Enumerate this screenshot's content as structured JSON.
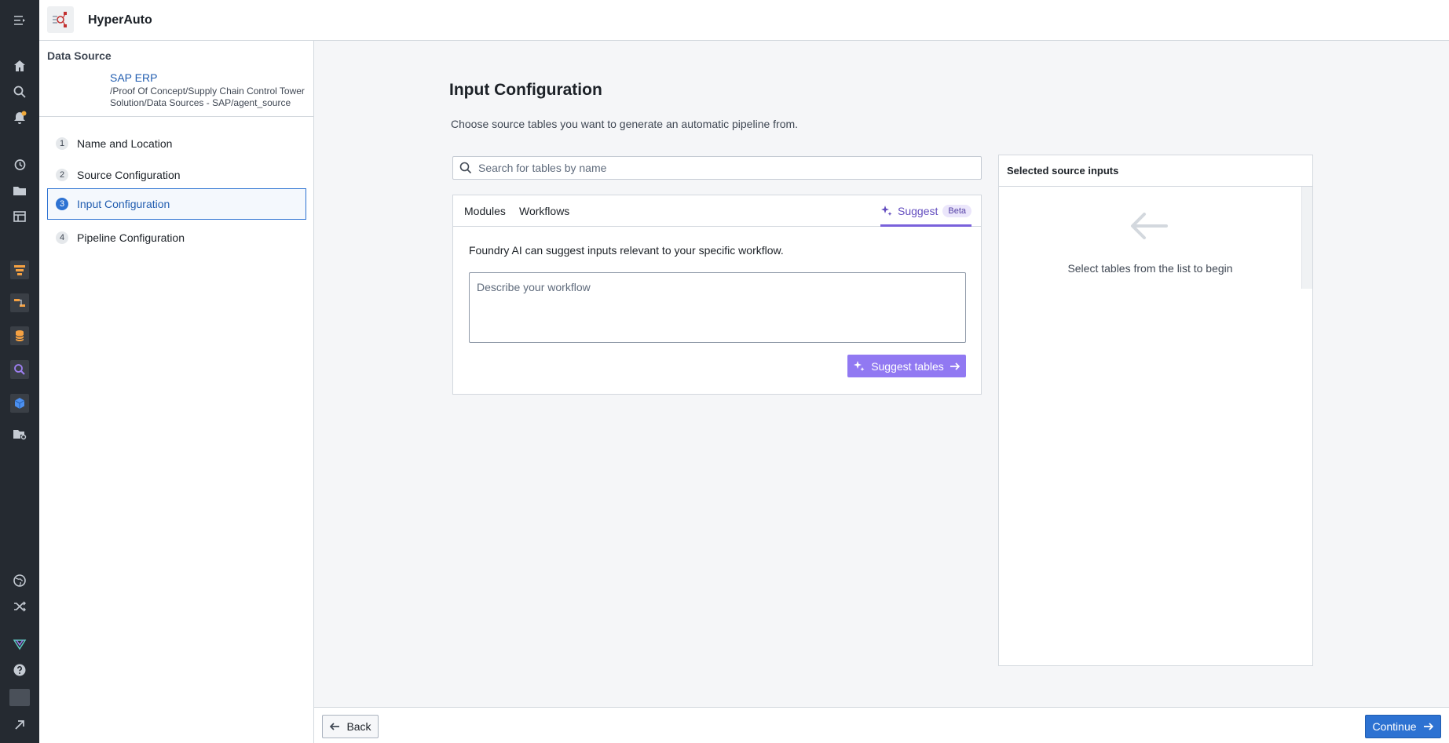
{
  "app": {
    "title": "HyperAuto"
  },
  "rail": {
    "icons": [
      "menu-icon",
      "home-icon",
      "search-icon",
      "notifications-icon",
      "history-icon",
      "folder-icon",
      "table-icon",
      "app-contour-icon",
      "app-pipeline-icon",
      "app-dataset-icon",
      "app-quiver-icon",
      "app-ontology-icon",
      "folder-settings-icon",
      "globe-icon",
      "shuffle-icon",
      "app-workshop-icon",
      "help-icon",
      "avatar",
      "expand-icon"
    ]
  },
  "sidebar": {
    "data_source_label": "Data Source",
    "source_name": "SAP ERP",
    "source_path": "/Proof Of Concept/Supply Chain Control Tower Solution/Data Sources - SAP/agent_source",
    "steps": [
      {
        "num": "1",
        "label": "Name and Location"
      },
      {
        "num": "2",
        "label": "Source Configuration"
      },
      {
        "num": "3",
        "label": "Input Configuration",
        "active": true
      },
      {
        "num": "4",
        "label": "Pipeline Configuration"
      }
    ]
  },
  "main": {
    "title": "Input Configuration",
    "subtitle": "Choose source tables you want to generate an automatic pipeline from.",
    "search_placeholder": "Search for tables by name",
    "tabs": {
      "modules": "Modules",
      "workflows": "Workflows",
      "suggest": "Suggest",
      "beta": "Beta"
    },
    "suggest_desc": "Foundry AI can suggest inputs relevant to your specific workflow.",
    "workflow_placeholder": "Describe your workflow",
    "suggest_button": "Suggest tables"
  },
  "selected": {
    "title": "Selected source inputs",
    "empty_text": "Select tables from the list to begin"
  },
  "footer": {
    "back": "Back",
    "continue": "Continue"
  },
  "colors": {
    "accent": "#2d72d2",
    "ai_purple": "#9179f2",
    "rail_bg": "#252a31"
  }
}
